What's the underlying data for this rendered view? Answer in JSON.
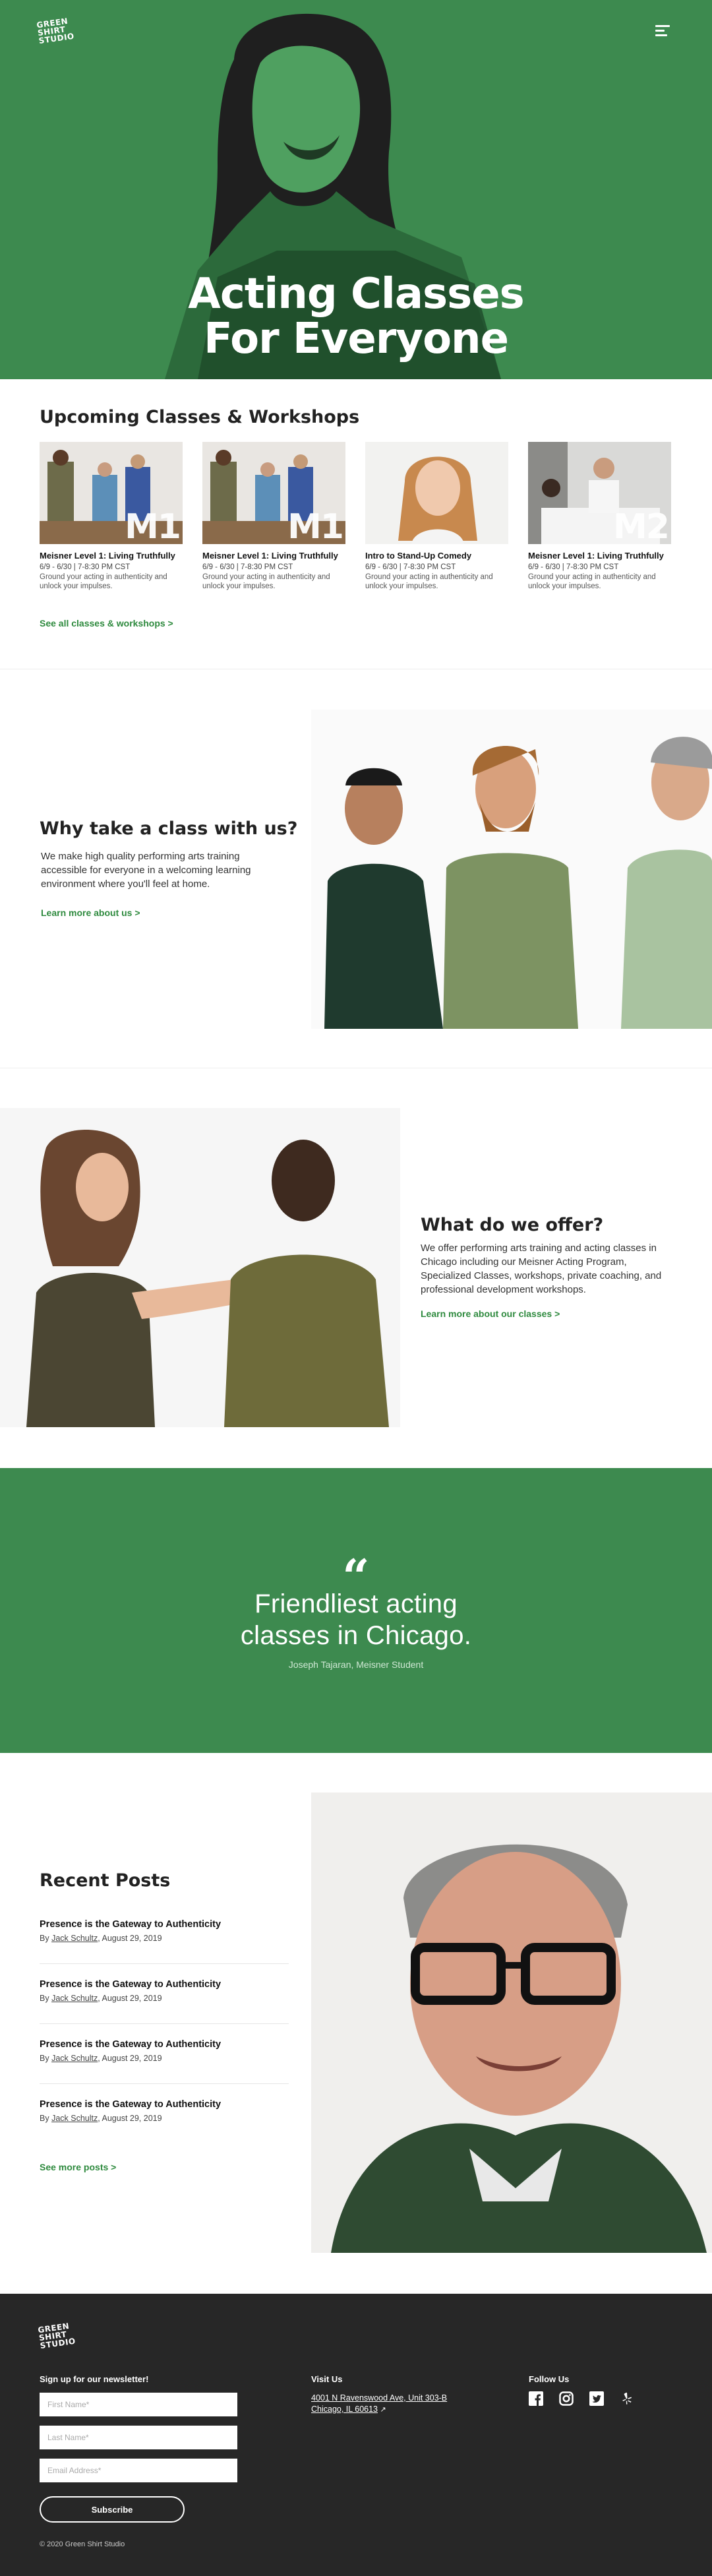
{
  "header": {
    "logo_lines": [
      "GREEN",
      "SHIRT",
      "STUDIO"
    ],
    "hero_title_line1": "Acting Classes",
    "hero_title_line2": "For Everyone"
  },
  "upcoming": {
    "heading": "Upcoming Classes & Workshops",
    "cards": [
      {
        "badge": "M1",
        "title": "Meisner Level 1: Living Truthfully",
        "date": "6/9 - 6/30 | 7-8:30 PM CST",
        "desc": "Ground your acting in authenticity and unlock your impulses."
      },
      {
        "badge": "M1",
        "title": "Meisner Level 1: Living Truthfully",
        "date": "6/9 - 6/30 | 7-8:30 PM CST",
        "desc": "Ground your acting in authenticity and unlock your impulses."
      },
      {
        "badge": "",
        "title": "Intro to Stand-Up Comedy",
        "date": "6/9 - 6/30 | 7-8:30 PM CST",
        "desc": "Ground your acting in authenticity and unlock your impulses."
      },
      {
        "badge": "M2",
        "title": "Meisner Level 1: Living Truthfully",
        "date": "6/9 - 6/30 | 7-8:30 PM CST",
        "desc": "Ground your acting in authenticity and unlock your impulses."
      }
    ],
    "link": "See all classes & workshops >"
  },
  "why": {
    "heading": "Why take a class with us?",
    "body": "We make high quality performing arts training accessible for everyone in a welcoming learning environment where you'll feel at home.",
    "link": "Learn more about us >"
  },
  "offer": {
    "heading": "What do we offer?",
    "body": "We offer performing arts training and acting classes in Chicago including our Meisner Acting Program, Specialized Classes, workshops, private coaching, and professional development workshops.",
    "link": "Learn more about our classes  >"
  },
  "quote": {
    "mark": "“",
    "line1": "Friendliest acting",
    "line2": "classes in Chicago.",
    "author": "Joseph Tajaran, Meisner Student"
  },
  "posts": {
    "heading": "Recent Posts",
    "items": [
      {
        "title": "Presence is the Gateway to Authenticity",
        "by": "By",
        "author": "Jack Schultz",
        "date": ", August 29, 2019"
      },
      {
        "title": "Presence is the Gateway to Authenticity",
        "by": "By",
        "author": "Jack Schultz",
        "date": ", August 29, 2019"
      },
      {
        "title": "Presence is the Gateway to Authenticity",
        "by": "By",
        "author": "Jack Schultz",
        "date": ", August 29, 2019"
      },
      {
        "title": "Presence is the Gateway to Authenticity",
        "by": "By",
        "author": "Jack Schultz",
        "date": ", August 29, 2019"
      }
    ],
    "link": "See more posts  >"
  },
  "footer": {
    "newsletter_heading": "Sign up for our newsletter!",
    "first_name_placeholder": "First Name*",
    "last_name_placeholder": "Last Name*",
    "email_placeholder": "Email Address*",
    "subscribe_label": "Subscribe",
    "visit_heading": "Visit Us",
    "address_line1": "4001 N Ravenswood Ave, Unit 303-B",
    "address_line2": "Chicago, IL 60613",
    "follow_heading": "Follow Us",
    "socials": [
      "facebook-icon",
      "instagram-icon",
      "twitter-icon",
      "yelp-icon"
    ],
    "copyright": "© 2020 Green Shirt Studio"
  },
  "colors": {
    "brand_green": "#3d8a4f",
    "link_green": "#2e8a3e",
    "footer_bg": "#272727"
  }
}
